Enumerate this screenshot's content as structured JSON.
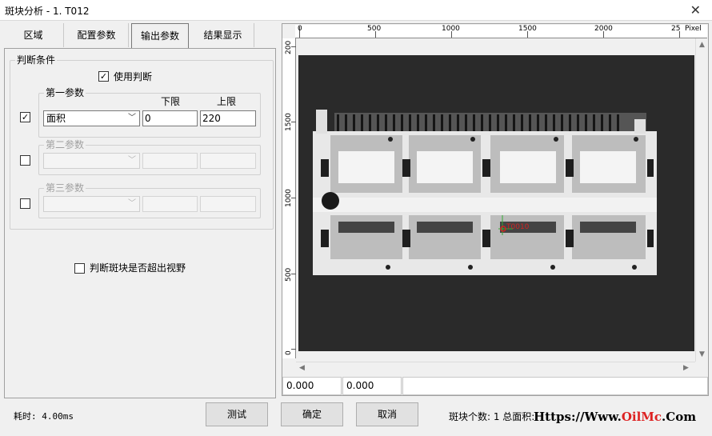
{
  "window": {
    "title": "斑块分析 - 1. T012",
    "close_glyph": "✕"
  },
  "tabs": [
    {
      "label": "区域",
      "active": false
    },
    {
      "label": "配置参数",
      "active": false
    },
    {
      "label": "输出参数",
      "active": true
    },
    {
      "label": "结果显示",
      "active": false
    }
  ],
  "criteria": {
    "group_label": "判断条件",
    "use_judge": {
      "label": "使用判断",
      "checked": true
    },
    "param1": {
      "group_label": "第一参数",
      "enabled": true,
      "checked": true,
      "lower_header": "下限",
      "upper_header": "上限",
      "selected": "面积",
      "lower": "0",
      "upper": "220"
    },
    "param2": {
      "group_label": "第二参数",
      "enabled": false,
      "checked": false
    },
    "param3": {
      "group_label": "第三参数",
      "enabled": false,
      "checked": false
    },
    "out_of_view": {
      "label": "判断斑块是否超出视野",
      "checked": false
    }
  },
  "viewer": {
    "h_ruler": {
      "ticks": [
        "0",
        "500",
        "1000",
        "1500",
        "2000",
        "25"
      ],
      "unit": "Pixel"
    },
    "v_ruler": {
      "ticks": [
        "200",
        "1500",
        "1000",
        "500",
        "0"
      ]
    },
    "overlay_label": "T0010",
    "coord_x": "0.000",
    "coord_y": "0.000"
  },
  "footer": {
    "time_label": "耗时:",
    "time_value": "4.00ms",
    "test_button": "测试",
    "ok_button": "确定",
    "cancel_button": "取消",
    "status": "斑块个数: 1 总面积: 1524 检测结果: NG 面积: Fail",
    "watermark_prefix": "Https://Www.",
    "watermark_brand": "OilMc",
    "watermark_suffix": ".Com"
  },
  "colors": {
    "image_background": "#2a2a2a",
    "overlay_marker": "#d22222",
    "overlay_axis": "#33aa33"
  }
}
